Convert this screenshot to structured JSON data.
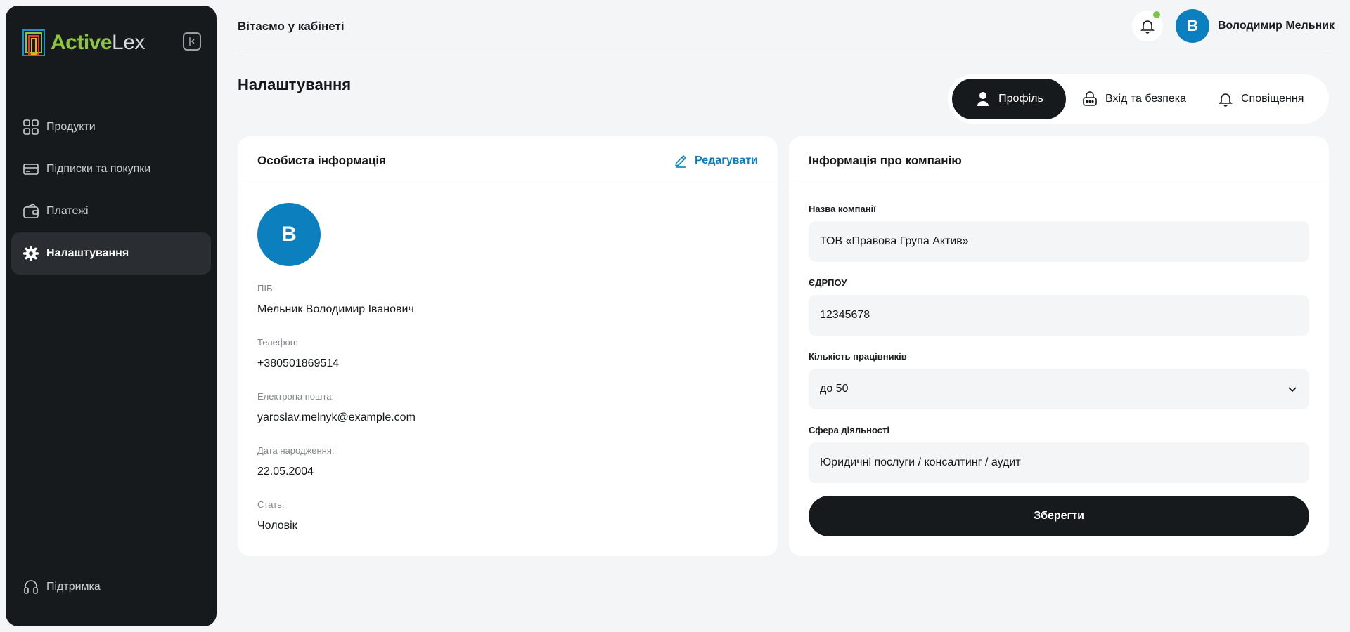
{
  "brand": {
    "name_part1": "Active",
    "name_part2": "Lex",
    "accent": "#8cc63f"
  },
  "sidebar": {
    "items": [
      {
        "label": "Продукти",
        "icon": "grid-icon"
      },
      {
        "label": "Підписки та покупки",
        "icon": "card-icon"
      },
      {
        "label": "Платежі",
        "icon": "wallet-icon"
      },
      {
        "label": "Налаштування",
        "icon": "gear-icon",
        "active": true
      }
    ],
    "support_label": "Підтримка"
  },
  "header": {
    "welcome": "Вітаємо у кабінеті",
    "user_initial": "В",
    "user_name": "Володимир Мельник"
  },
  "page": {
    "title": "Налаштування"
  },
  "tabs": [
    {
      "label": "Профіль",
      "icon": "user-icon",
      "active": true
    },
    {
      "label": "Вхід та безпека",
      "icon": "lock-icon"
    },
    {
      "label": "Сповіщення",
      "icon": "bell-icon"
    }
  ],
  "personal": {
    "title": "Особиста інформація",
    "edit_label": "Редагувати",
    "avatar_initial": "В",
    "fields": [
      {
        "label": "ПІБ:",
        "value": "Мельник Володимир Іванович"
      },
      {
        "label": "Телефон:",
        "value": "+380501869514"
      },
      {
        "label": "Електрона пошта:",
        "value": "yaroslav.melnyk@example.com"
      },
      {
        "label": "Дата народження:",
        "value": "22.05.2004"
      },
      {
        "label": "Стать:",
        "value": "Чоловік"
      }
    ]
  },
  "company": {
    "title": "Інформація про компанію",
    "fields": [
      {
        "label": "Назва компанії",
        "value": "ТОВ «Правова Група Актив»"
      },
      {
        "label": "ЄДРПОУ",
        "value": "12345678"
      },
      {
        "label": "Кількість працівників",
        "value": "до 50"
      },
      {
        "label": "Сфера діяльності",
        "value": "Юридичні послуги / консалтинг / аудит"
      }
    ],
    "save_label": "Зберегти"
  },
  "colors": {
    "primary_blue": "#0c7fbf",
    "dark": "#161a1d",
    "status_dot": "#7cc74a"
  }
}
